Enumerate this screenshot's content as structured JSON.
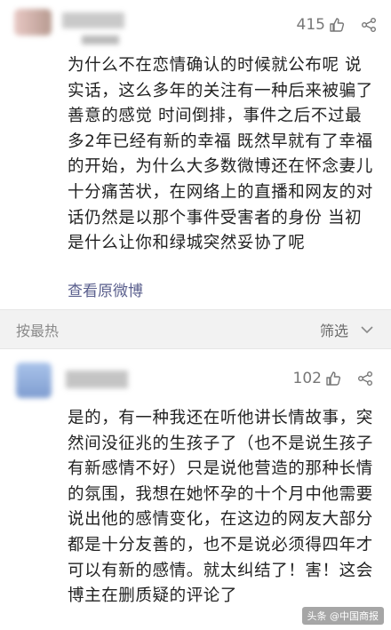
{
  "comments": [
    {
      "likes": "415",
      "text_lines": [
        "为什么不在恋情确认的时候就公布呢 说",
        "实话，这么多年的关注有一种后来被骗了",
        "善意的感觉 时间倒排，事件之后不过最",
        "多2年已经有新的幸福 既然早就有了幸福",
        "的开始，为什么大多数微博还在怀念妻儿",
        "十分痛苦状，在网络上的直播和网友的对",
        "话仍然是以那个事件受害者的身份 当初",
        "是什么让你和绿城突然妥协了呢"
      ],
      "view_original": "查看原微博"
    },
    {
      "likes": "102",
      "text_lines": [
        "是的，有一种我还在听他讲长情故事，突",
        "然间没征兆的生孩子了（也不是说生孩子",
        "有新感情不好）只是说他营造的那种长情",
        "的氛围，我想在她怀孕的十个月中他需要",
        "说出他的感情变化，在这边的网友大部分",
        "都是十分友善的，也不是说必须得四年才",
        "可以有新的感情。就太纠结了！害！这会",
        "博主在删质疑的评论了"
      ]
    }
  ],
  "sort_bar": {
    "sort_label": "按最热",
    "filter_label": "筛选"
  },
  "watermark": "头条 @中国商报",
  "icons": {
    "like": "thumbs-up-icon",
    "share": "share-icon",
    "filter_chevron": "chevron-down-icon"
  },
  "colors": {
    "link": "#5a5f8d",
    "sort_bar_bg": "#f2f2f2"
  }
}
